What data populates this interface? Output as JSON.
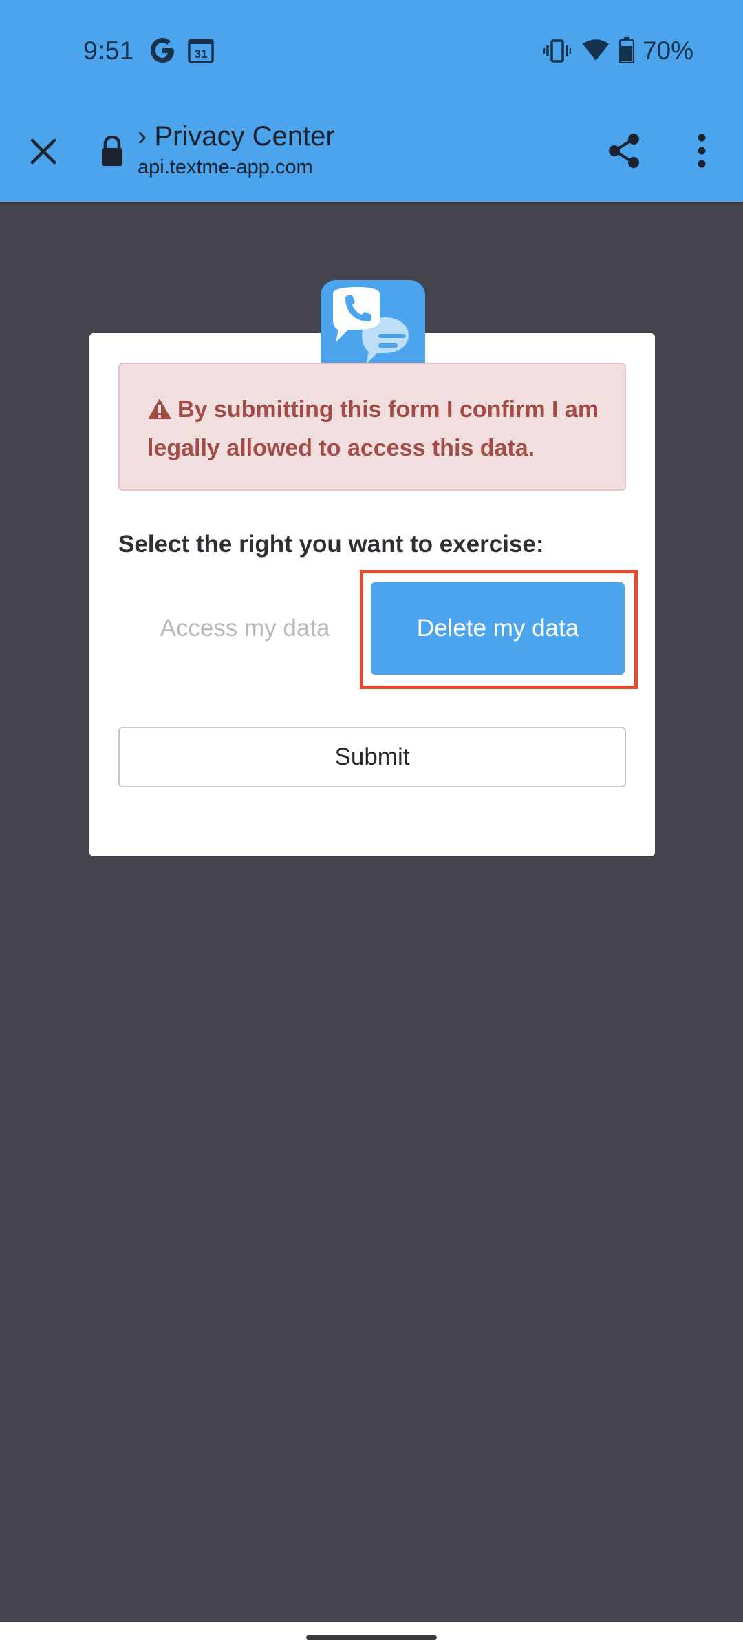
{
  "status_bar": {
    "time": "9:51",
    "battery": "70%",
    "icons": [
      "google-icon",
      "calendar-icon",
      "vibrate-icon",
      "wifi-icon",
      "battery-icon"
    ],
    "calendar_day": "31"
  },
  "toolbar": {
    "title": "› Privacy Center",
    "url": "api.textme-app.com",
    "icons": [
      "close-icon",
      "lock-icon",
      "share-icon",
      "more-vert-icon"
    ]
  },
  "form": {
    "alert_text": "By submitting this form I confirm I am legally allowed to access this data.",
    "select_label": "Select the right you want to exercise:",
    "options": [
      {
        "label": "Access my data",
        "selected": false
      },
      {
        "label": "Delete my data",
        "selected": true
      }
    ],
    "submit_label": "Submit"
  },
  "colors": {
    "accent": "#4ba4ec",
    "page_background": "#44444d",
    "alert_background": "#f1dedf",
    "alert_text": "#a24c48",
    "highlight_outline": "#e54b31"
  }
}
